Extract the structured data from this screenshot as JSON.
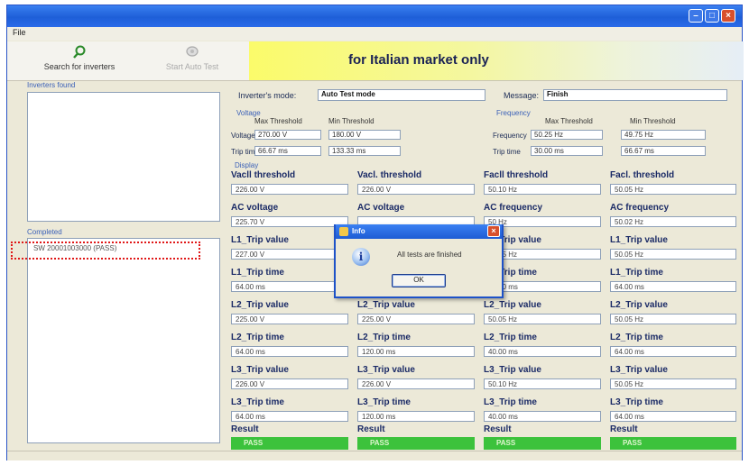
{
  "menu": {
    "file": "File"
  },
  "toolbar": {
    "search_label": "Search for inverters",
    "autotest_label": "Start Auto Test",
    "banner": "for Italian market only"
  },
  "panels": {
    "inverters_found": "Inverters found",
    "completed": "Completed",
    "completed_items": [
      "SW 20001003000 (PASS)"
    ]
  },
  "info": {
    "mode_label": "Inverter's mode:",
    "mode_value": "Auto Test mode",
    "message_label": "Message:",
    "message_value": "Finish"
  },
  "voltage": {
    "group": "Voltage",
    "max_header": "Max Threshold",
    "min_header": "Min Threshold",
    "voltage_label": "Voltage",
    "voltage_max": "270.00 V",
    "voltage_min": "180.00 V",
    "trip_label": "Trip time",
    "trip_max": "66.67 ms",
    "trip_min": "133.33 ms"
  },
  "frequency": {
    "group": "Frequency",
    "max_header": "Max Threshold",
    "min_header": "Min Threshold",
    "freq_label": "Frequency",
    "freq_max": "50.25 Hz",
    "freq_min": "49.75 Hz",
    "trip_label": "Trip time",
    "trip_max": "30.00 ms",
    "trip_min": "66.67 ms"
  },
  "display": {
    "group": "Display",
    "columns": [
      {
        "rows": [
          {
            "label": "Vacll threshold",
            "value": "226.00 V"
          },
          {
            "label": "AC voltage",
            "value": "225.70 V"
          },
          {
            "label": "L1_Trip value",
            "value": "227.00 V"
          },
          {
            "label": "L1_Trip time",
            "value": "64.00 ms"
          },
          {
            "label": "L2_Trip value",
            "value": "225.00 V"
          },
          {
            "label": "L2_Trip time",
            "value": "64.00 ms"
          },
          {
            "label": "L3_Trip value",
            "value": "226.00 V"
          },
          {
            "label": "L3_Trip time",
            "value": "64.00 ms"
          }
        ],
        "result_label": "Result",
        "result_value": "PASS"
      },
      {
        "rows": [
          {
            "label": "Vacl. threshold",
            "value": "226.00 V"
          },
          {
            "label": "AC voltage",
            "value": ""
          },
          {
            "label": "L1_Trip value",
            "value": ""
          },
          {
            "label": "L1_Trip time",
            "value": ""
          },
          {
            "label": "L2_Trip value",
            "value": "225.00 V"
          },
          {
            "label": "L2_Trip time",
            "value": "120.00 ms"
          },
          {
            "label": "L3_Trip value",
            "value": "226.00 V"
          },
          {
            "label": "L3_Trip time",
            "value": "120.00 ms"
          }
        ],
        "result_label": "Result",
        "result_value": "PASS"
      },
      {
        "rows": [
          {
            "label": "Facll threshold",
            "value": "50.10 Hz"
          },
          {
            "label": "AC frequency",
            "value": "50 Hz"
          },
          {
            "label": "L1_Trip value",
            "value": "50.05 Hz"
          },
          {
            "label": "L1_Trip time",
            "value": "40.00 ms"
          },
          {
            "label": "L2_Trip value",
            "value": "50.05 Hz"
          },
          {
            "label": "L2_Trip time",
            "value": "40.00 ms"
          },
          {
            "label": "L3_Trip value",
            "value": "50.10 Hz"
          },
          {
            "label": "L3_Trip time",
            "value": "40.00 ms"
          }
        ],
        "result_label": "Result",
        "result_value": "PASS"
      },
      {
        "rows": [
          {
            "label": "Facl. threshold",
            "value": "50.05 Hz"
          },
          {
            "label": "AC frequency",
            "value": "50.02 Hz"
          },
          {
            "label": "L1_Trip value",
            "value": "50.05 Hz"
          },
          {
            "label": "L1_Trip time",
            "value": "64.00 ms"
          },
          {
            "label": "L2_Trip value",
            "value": "50.05 Hz"
          },
          {
            "label": "L2_Trip time",
            "value": "64.00 ms"
          },
          {
            "label": "L3_Trip value",
            "value": "50.05 Hz"
          },
          {
            "label": "L3_Trip time",
            "value": "64.00 ms"
          }
        ],
        "result_label": "Result",
        "result_value": "PASS"
      }
    ]
  },
  "dialog": {
    "title": "Info",
    "message": "All tests are finished",
    "ok": "OK"
  },
  "colors": {
    "titlebar": "#1e5fd8",
    "banner": "#fbfb6a",
    "pass": "#3cc23c",
    "highlight": "#e01818"
  }
}
